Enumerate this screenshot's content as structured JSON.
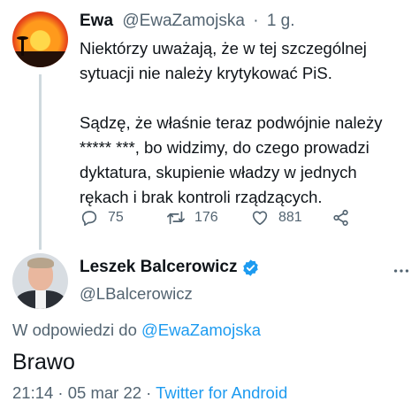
{
  "reply_tweet": {
    "author_name": "Ewa",
    "handle": "@EwaZamojska",
    "separator": "·",
    "time": "1 g.",
    "paragraph1": [
      "Niektórzy uważają, że w tej szczególnej",
      "sytuacji nie należy krytykować PiS."
    ],
    "paragraph2": [
      "Sądzę, że właśnie teraz podwójnie należy",
      "***** ***, bo widzimy, do czego prowadzi",
      "dyktatura, skupienie władzy w jednych",
      "rękach i brak kontroli rządzących."
    ],
    "stats": {
      "replies": "75",
      "retweets": "176",
      "likes": "881"
    }
  },
  "main_tweet": {
    "author_name": "Leszek Balcerowicz",
    "handle": "@LBalcerowicz",
    "reply_prefix": "W odpowiedzi do",
    "reply_handle": "@EwaZamojska",
    "text": "Brawo",
    "timestamp": "21:14 · 05 mar 22 ·",
    "source": "Twitter for Android"
  },
  "colors": {
    "link": "#1d9bf0",
    "secondary_text": "#536471",
    "verified": "#1d9bf0"
  },
  "icons": [
    "reply-icon",
    "retweet-icon",
    "like-icon",
    "share-icon",
    "verified-badge-icon",
    "more-options-icon"
  ]
}
